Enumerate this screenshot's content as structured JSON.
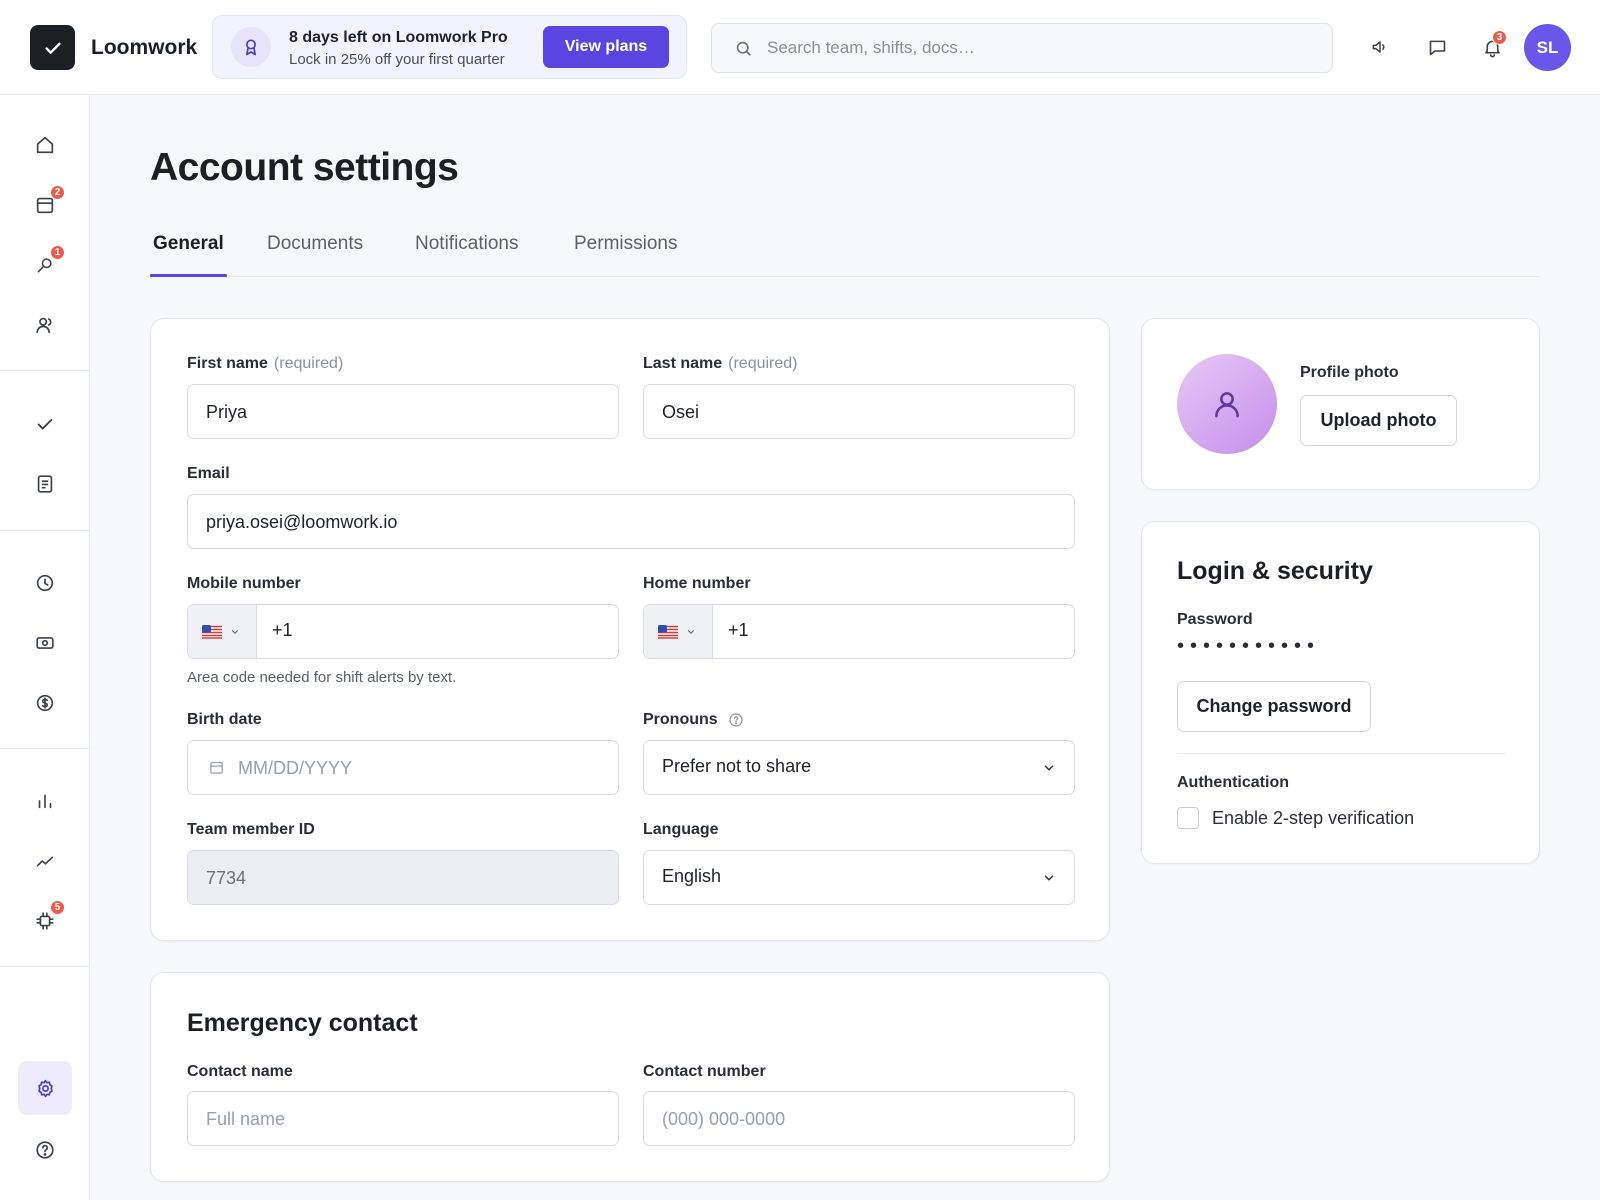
{
  "app": {
    "name": "Loomwork"
  },
  "promo": {
    "title": "8 days left on Loomwork Pro",
    "subtitle": "Lock in 25% off your first quarter",
    "button": "View plans"
  },
  "search": {
    "placeholder": "Search team, shifts, docs…"
  },
  "header_icons": {
    "notifications_count": "3"
  },
  "user": {
    "initials": "SL"
  },
  "sidebar": {
    "schedule_badge": "2",
    "hiring_badge": "1",
    "integrations_badge": "5"
  },
  "page": {
    "title": "Account settings"
  },
  "tabs": [
    {
      "label": "General",
      "active": true
    },
    {
      "label": "Documents",
      "active": false
    },
    {
      "label": "Notifications",
      "active": false
    },
    {
      "label": "Permissions",
      "active": false
    }
  ],
  "form": {
    "first_name": {
      "label": "First name",
      "hint": "(required)",
      "value": "Priya"
    },
    "last_name": {
      "label": "Last name",
      "hint": "(required)",
      "value": "Osei"
    },
    "email": {
      "label": "Email",
      "value": "priya.osei@loomwork.io"
    },
    "mobile": {
      "label": "Mobile number",
      "code": "+1",
      "help": "Area code needed for shift alerts by text."
    },
    "home": {
      "label": "Home number",
      "code": "+1"
    },
    "birth_date": {
      "label": "Birth date",
      "placeholder": "MM/DD/YYYY"
    },
    "pronouns": {
      "label": "Pronouns",
      "value": "Prefer not to share"
    },
    "team_member_id": {
      "label": "Team member ID",
      "value": "7734"
    },
    "language": {
      "label": "Language",
      "value": "English"
    }
  },
  "emergency": {
    "title": "Emergency contact",
    "contact_name": {
      "label": "Contact name",
      "placeholder": "Full name"
    },
    "contact_number": {
      "label": "Contact number",
      "placeholder": "(000) 000-0000"
    }
  },
  "profile_photo": {
    "label": "Profile photo",
    "button": "Upload photo"
  },
  "security": {
    "title": "Login & security",
    "password_label": "Password",
    "password_mask": "•••••••••••",
    "change_button": "Change password",
    "auth_label": "Authentication",
    "two_step_label": "Enable 2-step verification"
  },
  "colors": {
    "accent": "#5b45e0",
    "badge": "#f05b49"
  }
}
